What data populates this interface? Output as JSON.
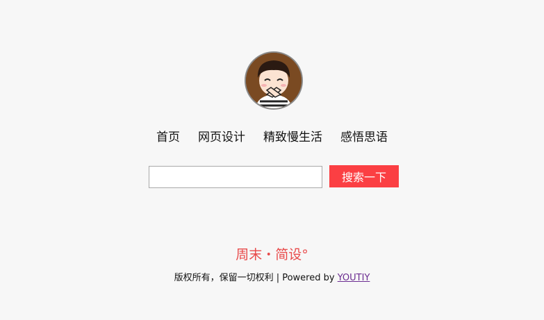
{
  "avatar": {
    "icon": "cartoon-boy-avatar-icon"
  },
  "nav": {
    "items": [
      {
        "label": "首页"
      },
      {
        "label": "网页设计"
      },
      {
        "label": "精致慢生活"
      },
      {
        "label": "感悟思语"
      }
    ]
  },
  "search": {
    "value": "",
    "placeholder": "",
    "button_label": "搜索一下"
  },
  "brand": {
    "title": "周末・简设°"
  },
  "footer": {
    "copyright": "版权所有，保留一切权利 | Powered by ",
    "link_label": "YOUTIY"
  },
  "colors": {
    "background": "#f7f7f7",
    "button": "#fb3f43",
    "brand": "#e84a4a",
    "link": "#6b2c91"
  }
}
